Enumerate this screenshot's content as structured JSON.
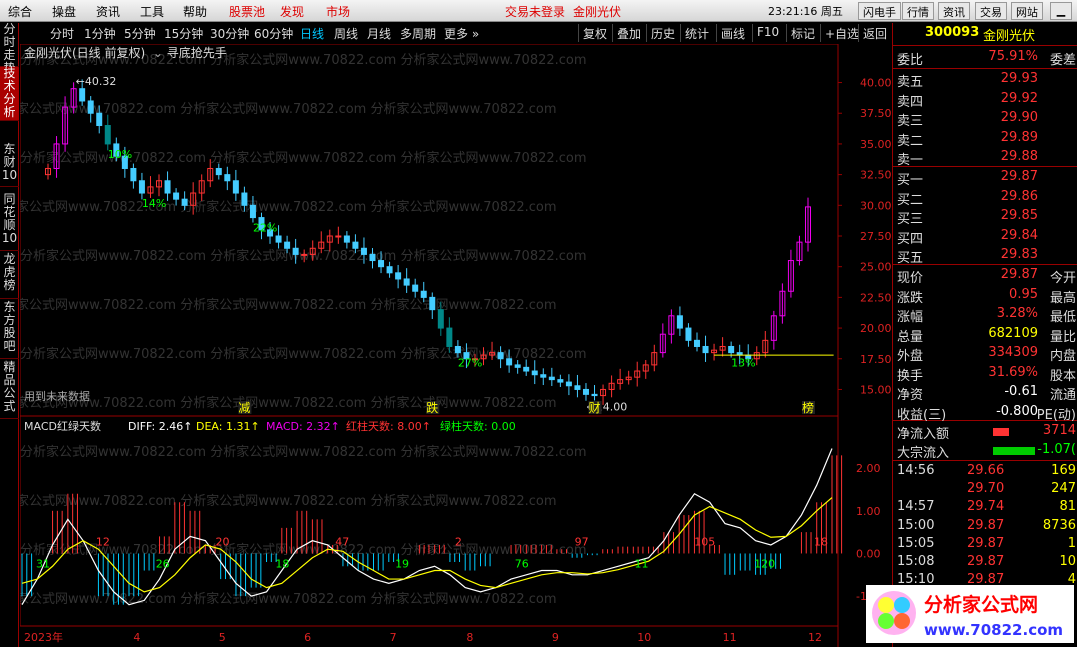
{
  "menu": {
    "items": [
      "综合",
      "操盘",
      "资讯",
      "工具",
      "帮助",
      "股票池",
      "发现",
      "市场"
    ],
    "status": "交易未登录",
    "stock": "金刚光伏",
    "clock": "23:21:16 周五",
    "buttons": [
      "闪电手",
      "行情",
      "资讯",
      "交易",
      "网站"
    ]
  },
  "lefttabs": [
    "分时走势",
    "技术分析",
    "东财10",
    "同花顺10",
    "龙虎榜",
    "东方股吧",
    "精品公式"
  ],
  "periods": [
    "分时",
    "1分钟",
    "5分钟",
    "15分钟",
    "30分钟",
    "60分钟",
    "日线",
    "周线",
    "月线",
    "多周期",
    "更多 »"
  ],
  "period_buttons": [
    "复权",
    "叠加",
    "历史",
    "统计",
    "画线",
    "F10",
    "标记",
    "+自选",
    "返回"
  ],
  "header": {
    "title": "金刚光伏(日线 前复权)",
    "indicator": "寻底抢先手"
  },
  "annotations": {
    "high": "40.32",
    "low": "14.00",
    "future": "用到未来数据",
    "markers": [
      "减",
      "跌",
      "财",
      "榜"
    ],
    "pcts": [
      "10%",
      "14%",
      "22%",
      "27%",
      "13%"
    ]
  },
  "macd_hdr": {
    "name": "MACD红绿天数",
    "diff": "DIFF: 2.46↑",
    "dea": "DEA: 1.31↑",
    "macd": "MACD: 2.32↑",
    "red": "红柱天数: 8.00↑",
    "green": "绿柱天数: 0.00"
  },
  "bar_counts": [
    "31",
    "12",
    "26",
    "20",
    "18",
    "47",
    "19",
    "2",
    "76",
    "97",
    "11",
    "105",
    "120",
    "18"
  ],
  "quote": {
    "code": "300093",
    "name": "金刚光伏",
    "wb_l": "委比",
    "wb_v": "75.91%",
    "wb_r": "委差",
    "sell": [
      {
        "l": "卖五",
        "p": "29.93"
      },
      {
        "l": "卖四",
        "p": "29.92"
      },
      {
        "l": "卖三",
        "p": "29.90"
      },
      {
        "l": "卖二",
        "p": "29.89"
      },
      {
        "l": "卖一",
        "p": "29.88"
      }
    ],
    "buy": [
      {
        "l": "买一",
        "p": "29.87"
      },
      {
        "l": "买二",
        "p": "29.86"
      },
      {
        "l": "买三",
        "p": "29.85"
      },
      {
        "l": "买四",
        "p": "29.84"
      },
      {
        "l": "买五",
        "p": "29.83"
      }
    ],
    "stats": [
      {
        "l": "现价",
        "v": "29.87",
        "r": "今开"
      },
      {
        "l": "涨跌",
        "v": "0.95",
        "r": "最高"
      },
      {
        "l": "涨幅",
        "v": "3.28%",
        "r": "最低"
      },
      {
        "l": "总量",
        "v": "682109",
        "r": "量比"
      },
      {
        "l": "外盘",
        "v": "334309",
        "r": "内盘"
      },
      {
        "l": "换手",
        "v": "31.69%",
        "r": "股本"
      },
      {
        "l": "净资",
        "v": "-0.61",
        "r": "流通"
      },
      {
        "l": "收益(三)",
        "v": "-0.800",
        "r": "PE(动)"
      }
    ],
    "flow": [
      {
        "l": "净流入额",
        "v": "3714"
      },
      {
        "l": "大宗流入",
        "v": "-1.07("
      }
    ],
    "ticks": [
      {
        "t": "14:56",
        "p": "29.66",
        "v": "169"
      },
      {
        "t": "",
        "p": "29.70",
        "v": "247"
      },
      {
        "t": "14:57",
        "p": "29.74",
        "v": "81"
      },
      {
        "t": "15:00",
        "p": "29.87",
        "v": "8736"
      },
      {
        "t": "15:05",
        "p": "29.87",
        "v": "1"
      },
      {
        "t": "15:08",
        "p": "29.87",
        "v": "10"
      },
      {
        "t": "15:10",
        "p": "29.87",
        "v": "4"
      }
    ]
  },
  "chart_data": {
    "type": "candlestick",
    "title": "金刚光伏(日线 前复权)",
    "ylim": [
      13,
      42
    ],
    "yticks": [
      "40.00",
      "37.50",
      "35.00",
      "32.50",
      "30.00",
      "27.50",
      "25.00",
      "22.50",
      "20.00",
      "17.50",
      "15.00"
    ],
    "months": [
      "2023年",
      "4",
      "5",
      "6",
      "7",
      "8",
      "9",
      "10",
      "11",
      "12"
    ],
    "close": [
      33,
      35,
      38,
      39.5,
      38.5,
      37.5,
      36.5,
      35,
      34,
      33,
      32,
      31,
      31.5,
      32,
      31,
      30.5,
      30,
      31,
      32,
      33,
      32.5,
      32,
      31,
      30,
      29,
      28,
      27.5,
      27,
      26.5,
      26,
      26,
      26.5,
      27,
      27.5,
      27.5,
      27,
      26.5,
      26,
      25.5,
      25,
      24.5,
      24,
      23.5,
      23,
      22.5,
      21.5,
      20,
      18.5,
      18,
      17.5,
      17.5,
      17.8,
      18,
      17.5,
      17,
      16.8,
      16.5,
      16.2,
      16,
      15.8,
      15.6,
      15.3,
      15,
      14.6,
      14.5,
      15,
      15.5,
      15.8,
      16,
      16.5,
      17,
      18,
      19.5,
      21,
      20,
      19,
      18.5,
      18,
      18.2,
      18.5,
      18,
      17.8,
      17.5,
      18,
      19,
      21,
      23,
      25.5,
      27,
      29.87
    ],
    "macd_diff": [
      -1.2,
      -0.6,
      0.2,
      0.8,
      0.3,
      -0.4,
      -0.9,
      -1.2,
      -1.1,
      -0.6,
      0.1,
      0.4,
      0.3,
      -0.2,
      -0.7,
      -1.0,
      -0.9,
      -0.4,
      0.1,
      0.3,
      0.2,
      -0.1,
      -0.4,
      -0.6,
      -0.7,
      -0.6,
      -0.4,
      -0.3,
      -0.5,
      -0.8,
      -0.9,
      -0.8,
      -0.6,
      -0.5,
      -0.4,
      -0.4,
      -0.5,
      -0.5,
      -0.4,
      -0.3,
      -0.2,
      -0.1,
      0.3,
      0.9,
      1.4,
      1.2,
      0.7,
      0.6,
      0.3,
      0.2,
      0.4,
      0.9,
      1.6,
      2.46
    ],
    "macd_dea": [
      -0.7,
      -0.6,
      -0.3,
      0.1,
      0.3,
      0.1,
      -0.3,
      -0.7,
      -0.9,
      -0.8,
      -0.5,
      -0.1,
      0.2,
      0.1,
      -0.2,
      -0.6,
      -0.8,
      -0.7,
      -0.4,
      -0.1,
      0.1,
      0.05,
      -0.2,
      -0.4,
      -0.6,
      -0.6,
      -0.5,
      -0.4,
      -0.4,
      -0.6,
      -0.75,
      -0.8,
      -0.7,
      -0.6,
      -0.5,
      -0.45,
      -0.45,
      -0.48,
      -0.45,
      -0.38,
      -0.28,
      -0.18,
      0.05,
      0.45,
      0.9,
      1.1,
      0.95,
      0.8,
      0.55,
      0.38,
      0.4,
      0.65,
      1.0,
      1.31
    ],
    "macd_yticks": [
      "2.00",
      "1.00",
      "0.00",
      "-1.00"
    ]
  }
}
